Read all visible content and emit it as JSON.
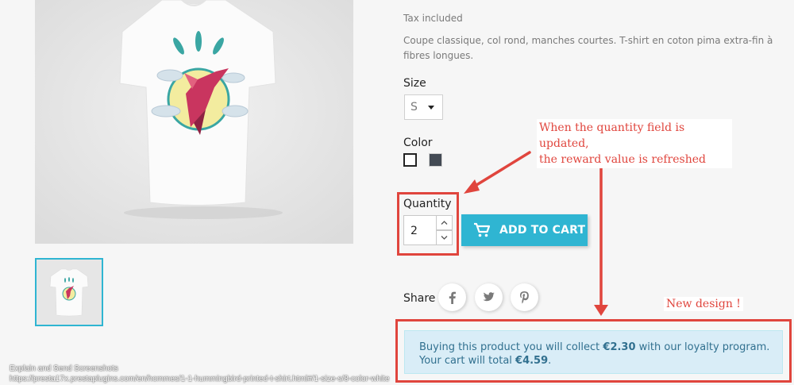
{
  "product": {
    "tax_note": "Tax included",
    "description": "Coupe classique, col rond, manches courtes. T-shirt en coton pima extra-fin à fibres longues.",
    "image_alt": "Hummingbird printed t-shirt",
    "thumbnail_alt": "Hummingbird printed t-shirt thumbnail"
  },
  "variants": {
    "size_label": "Size",
    "size_selected": "S",
    "color_label": "Color",
    "colors": [
      "#ffffff",
      "#434a54"
    ]
  },
  "quantity": {
    "label": "Quantity",
    "value": "2"
  },
  "cart": {
    "add_to_cart_label": "ADD TO CART"
  },
  "share": {
    "label": "Share",
    "icons": [
      "facebook-icon",
      "twitter-icon",
      "pinterest-icon"
    ]
  },
  "annotations": {
    "quantity_note_line1": "When the quantity field is updated,",
    "quantity_note_line2": "the reward value is refreshed",
    "new_design": "New design !"
  },
  "loyalty": {
    "line1_prefix": "Buying this product you will collect ",
    "line1_amount": "€2.30",
    "line1_suffix": " with our loyalty program.",
    "line2_prefix": "Your cart will total ",
    "line2_amount": "€4.59",
    "line2_suffix": "."
  },
  "watermark": {
    "line1": "Explain and Send Screenshots",
    "line2": "https://presta17x.prestaplugins.com/en/hommes/1-1-hummingbird-printed-t-shirt.html#/1-size-s/8-color-white"
  },
  "colors": {
    "accent": "#2fb5d2",
    "annotation": "#e0453d",
    "alert_bg": "#d9edf7",
    "alert_text": "#31708f"
  }
}
